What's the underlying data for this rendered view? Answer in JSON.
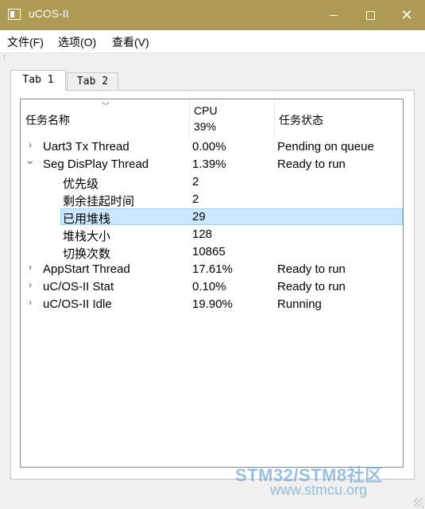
{
  "window": {
    "title": "uCOS-II"
  },
  "menu": [
    {
      "label": "文件(F)"
    },
    {
      "label": "选项(O)"
    },
    {
      "label": "查看(V)"
    }
  ],
  "tabs": [
    {
      "label": "Tab 1",
      "active": true
    },
    {
      "label": "Tab 2",
      "active": false
    }
  ],
  "tree": {
    "headers": {
      "name": "任务名称",
      "cpu": "CPU",
      "cpu_total": "39%",
      "status": "任务状态"
    },
    "rows": [
      {
        "arrow": "›",
        "name": "Uart3 Tx Thread",
        "cpu": "0.00%",
        "status": "Pending on queue"
      },
      {
        "arrow": "⌄",
        "name": "Seg DisPlay Thread",
        "cpu": "1.39%",
        "status": "Ready to run"
      },
      {
        "arrow": "",
        "name": "优先级",
        "cpu": "2",
        "status": ""
      },
      {
        "arrow": "",
        "name": "剩余挂起时间",
        "cpu": "2",
        "status": ""
      },
      {
        "arrow": "",
        "name": "已用堆栈",
        "cpu": "29",
        "status": ""
      },
      {
        "arrow": "",
        "name": "堆栈大小",
        "cpu": "128",
        "status": ""
      },
      {
        "arrow": "",
        "name": "切换次数",
        "cpu": "10865",
        "status": ""
      },
      {
        "arrow": "›",
        "name": "AppStart Thread",
        "cpu": "17.61%",
        "status": "Ready to run"
      },
      {
        "arrow": "›",
        "name": "uC/OS-II Stat",
        "cpu": "0.10%",
        "status": "Ready to run"
      },
      {
        "arrow": "›",
        "name": "uC/OS-II Idle",
        "cpu": "19.90%",
        "status": "Running"
      }
    ]
  },
  "watermark": {
    "brand": "STM32/STM8社区",
    "url": "www.stmcu.org"
  }
}
